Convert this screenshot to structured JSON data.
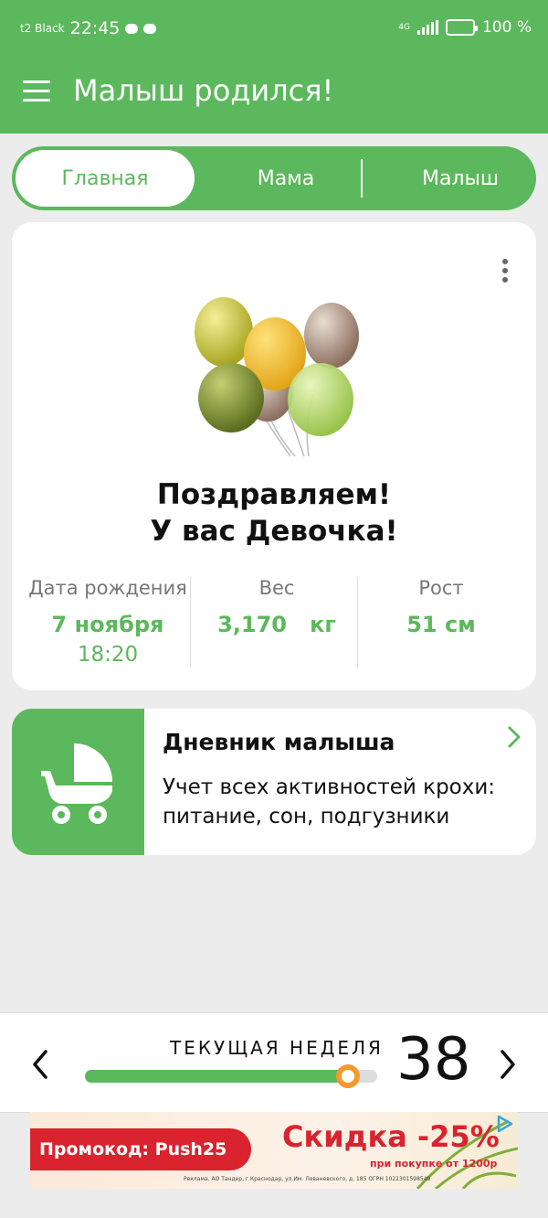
{
  "status_bar": {
    "carrier": "t2 Black",
    "time": "22:45",
    "network": "4G",
    "battery": "100 %"
  },
  "app_bar": {
    "title": "Малыш родился!"
  },
  "tabs": [
    {
      "label": "Главная",
      "active": true
    },
    {
      "label": "Мама",
      "active": false
    },
    {
      "label": "Малыш",
      "active": false
    }
  ],
  "congrats_card": {
    "message_line1": "Поздравляем!",
    "message_line2": "У вас Девочка!",
    "stats": {
      "birth": {
        "label": "Дата рождения",
        "value": "7 ноября",
        "time": "18:20"
      },
      "weight": {
        "label": "Вес",
        "value": "3,170   кг"
      },
      "height": {
        "label": "Рост",
        "value": "51 см"
      }
    }
  },
  "diary_card": {
    "title": "Дневник малыша",
    "description": "Учет всех активностей крохи: питание, сон, подгузники"
  },
  "week_bar": {
    "label": "ТЕКУЩАЯ НЕДЕЛЯ",
    "week": "38",
    "progress": 0.9
  },
  "ad": {
    "promo": "Промокод: Push25",
    "discount": "Скидка -25%",
    "condition": "при покупке от 1200р",
    "fine_print": "Реклама. АО Тандер, г.Краснодар, ул.Им. Леваневского, д. 185 ОГРН 1022301598549"
  },
  "colors": {
    "primary": "#5cb85c",
    "accent": "#f39a2e",
    "ad_red": "#d9232e"
  }
}
